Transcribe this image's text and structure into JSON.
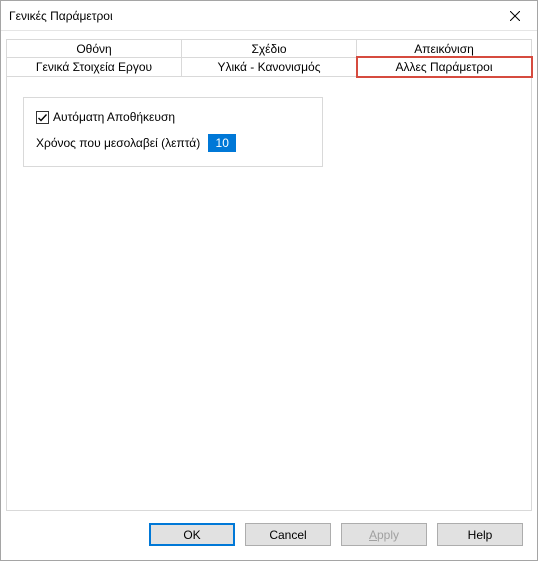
{
  "window": {
    "title": "Γενικές Παράμετροι"
  },
  "tabs": {
    "row1": [
      {
        "label": "Οθόνη"
      },
      {
        "label": "Σχέδιο"
      },
      {
        "label": "Απεικόνιση"
      }
    ],
    "row2": [
      {
        "label": "Γενικά Στοιχεία Εργου"
      },
      {
        "label": "Υλικά - Κανονισμός"
      },
      {
        "label": "Αλλες Παράμετροι"
      }
    ]
  },
  "panel": {
    "autosave_label": "Αυτόματη Αποθήκευση",
    "autosave_checked": true,
    "interval_label": "Χρόνος που μεσολαβεί (λεπτά)",
    "interval_value": "10"
  },
  "buttons": {
    "ok": "OK",
    "cancel": "Cancel",
    "apply_prefix": "A",
    "apply_rest": "pply",
    "help": "Help"
  }
}
